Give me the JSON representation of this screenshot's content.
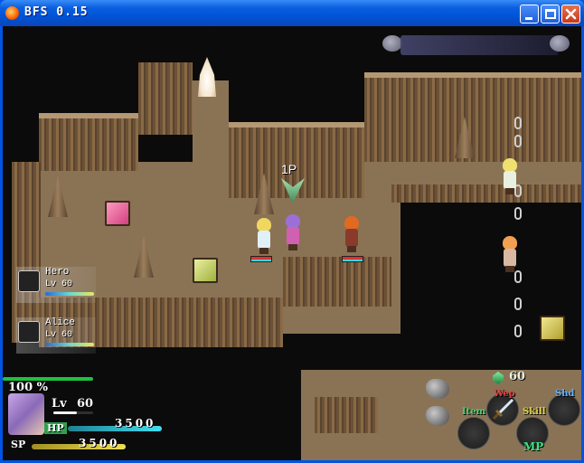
{
  "window": {
    "title": "BFS 0.15"
  },
  "map": {
    "player_marker": "1P"
  },
  "party": [
    {
      "name": "Hero",
      "level": "Lv 60"
    },
    {
      "name": "Alice",
      "level": "Lv 60"
    }
  ],
  "hud": {
    "percent": "100 %",
    "level_label": "Lv",
    "level": "60",
    "hp_label": "HP",
    "hp": "3500",
    "sp_label": "SP",
    "sp": "3500",
    "gem_count": "60",
    "mp_label": "MP"
  },
  "actions": [
    {
      "label": "Wep",
      "color": "#e04040"
    },
    {
      "label": "Shd",
      "color": "#60b0ff"
    },
    {
      "label": "Item",
      "color": "#50d070"
    },
    {
      "label": "Skill",
      "color": "#d8d040"
    }
  ],
  "colors": {
    "titlebar": "#0054e3",
    "cave_floor": "#8a7355",
    "hp_bar": "#30d8e0",
    "sp_bar": "#e8d850"
  }
}
